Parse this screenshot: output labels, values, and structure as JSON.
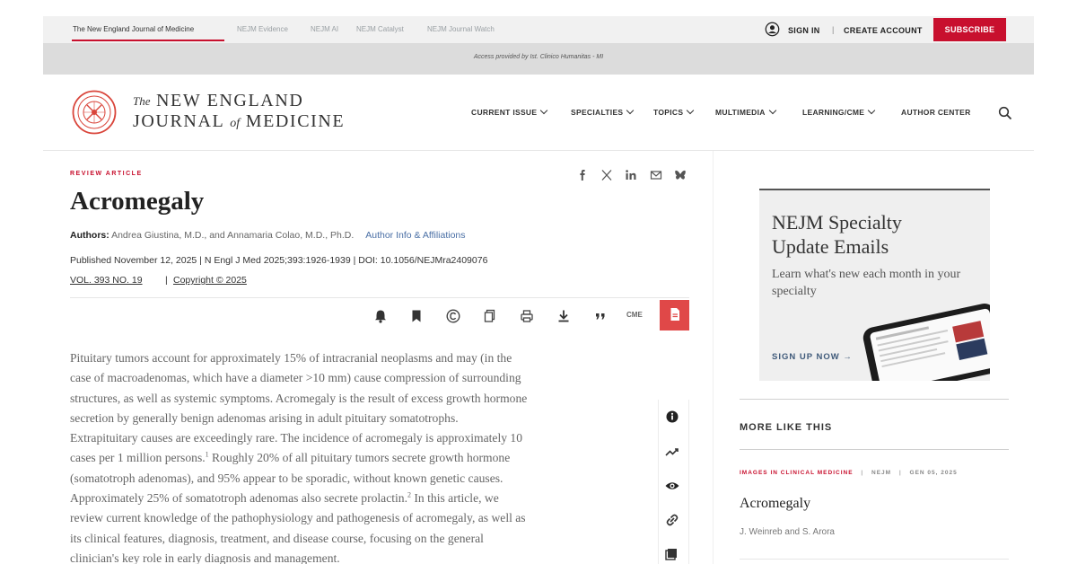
{
  "topbar": {
    "tabs": [
      "The New England Journal of Medicine",
      "NEJM Evidence",
      "NEJM AI",
      "NEJM Catalyst",
      "NEJM Journal Watch"
    ],
    "sign_in": "SIGN IN",
    "separator": "|",
    "create_account": "CREATE ACCOUNT",
    "subscribe": "SUBSCRIBE"
  },
  "access_note": "Access provided by Ist. Clinico Humanitas - MI",
  "header": {
    "logo_the": "The",
    "logo_line1": "NEW ENGLAND",
    "logo_journal": "JOURNAL",
    "logo_of": "of",
    "logo_medicine": "MEDICINE",
    "nav": [
      "CURRENT ISSUE",
      "SPECIALTIES",
      "TOPICS",
      "MULTIMEDIA",
      "LEARNING/CME",
      "AUTHOR CENTER"
    ]
  },
  "article": {
    "kicker": "REVIEW ARTICLE",
    "title": "Acromegaly",
    "authors_label": "Authors:",
    "authors": "Andrea Giustina, M.D., and Annamaria Colao, M.D., Ph.D.",
    "author_info": "Author Info & Affiliations",
    "published": "Published November 12, 2025  |  N Engl J Med 2025;393:1926-1939  |  DOI: 10.1056/NEJMra2409076",
    "volume": "VOL. 393 NO. 19",
    "vol_separator": "|",
    "copyright": "Copyright © 2025",
    "cme_label": "CME",
    "body_lines": [
      {
        "text": "Pituitary tumors account for approximately 15% of intracranial neoplasms and may (in the",
        "sup": "",
        "after": ""
      },
      {
        "text": "case of macroadenomas, which have a diameter >10 mm) cause compression of surrounding",
        "sup": "",
        "after": ""
      },
      {
        "text": "structures, as well as systemic symptoms. Acromegaly is the result of excess growth hormone",
        "sup": "",
        "after": ""
      },
      {
        "text": "secretion by generally benign adenomas arising in adult pituitary somatotrophs.",
        "sup": "",
        "after": ""
      },
      {
        "text": "Extrapituitary causes are exceedingly rare. The incidence of acromegaly is approximately 10",
        "sup": "",
        "after": ""
      },
      {
        "text": "cases per 1 million persons.",
        "sup": "1",
        "after": " Roughly 20% of all pituitary tumors secrete growth hormone"
      },
      {
        "text": "(somatotroph adenomas), and 95% appear to be sporadic, without known genetic causes.",
        "sup": "",
        "after": ""
      },
      {
        "text": "Approximately 25% of somatotroph adenomas also secrete prolactin.",
        "sup": "2",
        "after": " In this article, we"
      },
      {
        "text": "review current knowledge of the pathophysiology and pathogenesis of acromegaly, as well as",
        "sup": "",
        "after": ""
      },
      {
        "text": "its clinical features, diagnosis, treatment, and disease course, focusing on the general",
        "sup": "",
        "after": ""
      },
      {
        "text": "clinician's key role in early diagnosis and management.",
        "sup": "",
        "after": ""
      }
    ]
  },
  "ad": {
    "title": "NEJM Specialty Update Emails",
    "subtitle": "Learn what's new each month in your specialty",
    "cta": "SIGN UP NOW →"
  },
  "more_like_this": {
    "heading": "MORE LIKE THIS",
    "category": "IMAGES IN CLINICAL MEDICINE",
    "journal": "NEJM",
    "date": "GEN 05, 2025",
    "title": "Acromegaly",
    "authors": "J. Weinreb and S. Arora"
  },
  "colors": {
    "brand_red": "#c8102e",
    "pdf_red": "#e04848",
    "link_blue": "#4a6fa5"
  }
}
